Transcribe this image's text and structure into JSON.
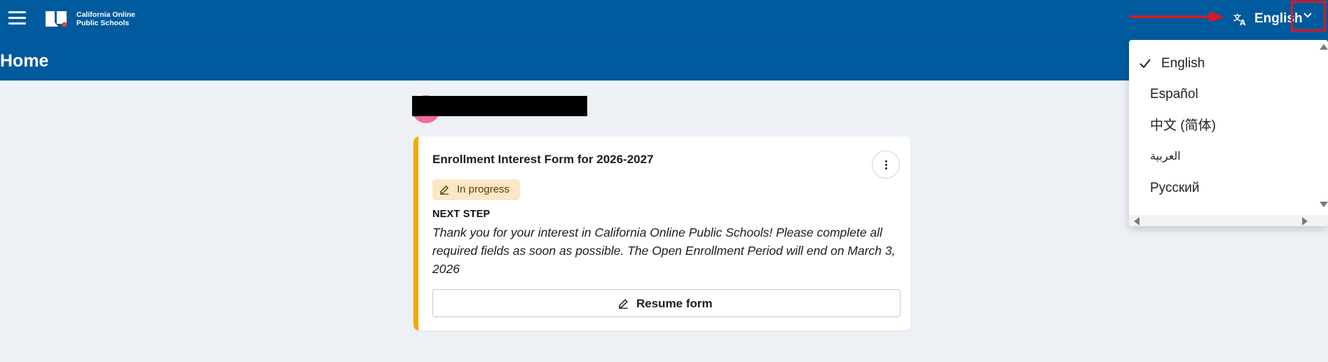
{
  "header": {
    "menu_icon": "hamburger-icon",
    "logo": {
      "line1": "California Online",
      "line2": "Public Schools",
      "icon": "book-logo-icon"
    },
    "language": {
      "icon": "translate-icon",
      "current": "English",
      "toggle_icon": "chevron-down-icon"
    },
    "annotation_arrow_color": "#e0171f"
  },
  "page": {
    "title": "Home"
  },
  "card": {
    "title": "Enrollment Interest Form for 2026-2027",
    "menu_icon": "more-vertical-icon",
    "status": {
      "icon": "pencil-icon",
      "label": "In progress"
    },
    "next_step_label": "NEXT STEP",
    "next_step_text": "Thank you for your interest in California Online Public Schools! Please complete all required fields as soon as possible. The Open Enrollment Period will end on March 3, 2026",
    "action": {
      "icon": "pencil-icon",
      "label": "Resume form"
    }
  },
  "language_menu": {
    "items": [
      {
        "label": "English",
        "selected": true
      },
      {
        "label": "Español",
        "selected": false
      },
      {
        "label": "中文 (简体)",
        "selected": false
      },
      {
        "label": "العربية",
        "selected": false
      },
      {
        "label": "Русский",
        "selected": false
      }
    ]
  },
  "colors": {
    "header_bg": "#005a9e",
    "page_bg": "#edf1f5",
    "card_accent": "#f5a800",
    "badge_bg": "#fbe7c6",
    "highlight_red": "#e0171f"
  }
}
